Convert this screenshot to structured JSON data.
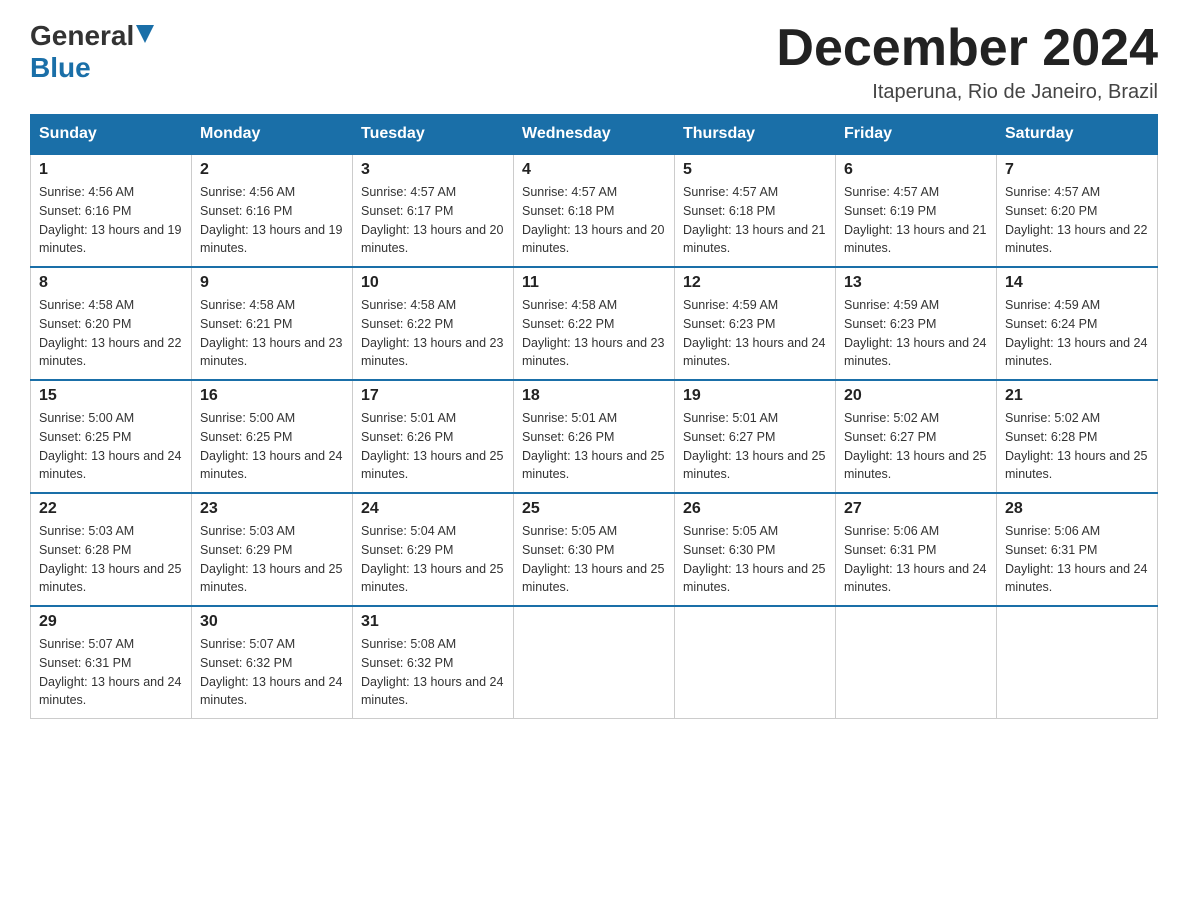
{
  "logo": {
    "part1": "General",
    "part2": "Blue"
  },
  "title": {
    "month_year": "December 2024",
    "location": "Itaperuna, Rio de Janeiro, Brazil"
  },
  "weekdays": [
    "Sunday",
    "Monday",
    "Tuesday",
    "Wednesday",
    "Thursday",
    "Friday",
    "Saturday"
  ],
  "weeks": [
    [
      {
        "day": "1",
        "sunrise": "4:56 AM",
        "sunset": "6:16 PM",
        "daylight": "13 hours and 19 minutes."
      },
      {
        "day": "2",
        "sunrise": "4:56 AM",
        "sunset": "6:16 PM",
        "daylight": "13 hours and 19 minutes."
      },
      {
        "day": "3",
        "sunrise": "4:57 AM",
        "sunset": "6:17 PM",
        "daylight": "13 hours and 20 minutes."
      },
      {
        "day": "4",
        "sunrise": "4:57 AM",
        "sunset": "6:18 PM",
        "daylight": "13 hours and 20 minutes."
      },
      {
        "day": "5",
        "sunrise": "4:57 AM",
        "sunset": "6:18 PM",
        "daylight": "13 hours and 21 minutes."
      },
      {
        "day": "6",
        "sunrise": "4:57 AM",
        "sunset": "6:19 PM",
        "daylight": "13 hours and 21 minutes."
      },
      {
        "day": "7",
        "sunrise": "4:57 AM",
        "sunset": "6:20 PM",
        "daylight": "13 hours and 22 minutes."
      }
    ],
    [
      {
        "day": "8",
        "sunrise": "4:58 AM",
        "sunset": "6:20 PM",
        "daylight": "13 hours and 22 minutes."
      },
      {
        "day": "9",
        "sunrise": "4:58 AM",
        "sunset": "6:21 PM",
        "daylight": "13 hours and 23 minutes."
      },
      {
        "day": "10",
        "sunrise": "4:58 AM",
        "sunset": "6:22 PM",
        "daylight": "13 hours and 23 minutes."
      },
      {
        "day": "11",
        "sunrise": "4:58 AM",
        "sunset": "6:22 PM",
        "daylight": "13 hours and 23 minutes."
      },
      {
        "day": "12",
        "sunrise": "4:59 AM",
        "sunset": "6:23 PM",
        "daylight": "13 hours and 24 minutes."
      },
      {
        "day": "13",
        "sunrise": "4:59 AM",
        "sunset": "6:23 PM",
        "daylight": "13 hours and 24 minutes."
      },
      {
        "day": "14",
        "sunrise": "4:59 AM",
        "sunset": "6:24 PM",
        "daylight": "13 hours and 24 minutes."
      }
    ],
    [
      {
        "day": "15",
        "sunrise": "5:00 AM",
        "sunset": "6:25 PM",
        "daylight": "13 hours and 24 minutes."
      },
      {
        "day": "16",
        "sunrise": "5:00 AM",
        "sunset": "6:25 PM",
        "daylight": "13 hours and 24 minutes."
      },
      {
        "day": "17",
        "sunrise": "5:01 AM",
        "sunset": "6:26 PM",
        "daylight": "13 hours and 25 minutes."
      },
      {
        "day": "18",
        "sunrise": "5:01 AM",
        "sunset": "6:26 PM",
        "daylight": "13 hours and 25 minutes."
      },
      {
        "day": "19",
        "sunrise": "5:01 AM",
        "sunset": "6:27 PM",
        "daylight": "13 hours and 25 minutes."
      },
      {
        "day": "20",
        "sunrise": "5:02 AM",
        "sunset": "6:27 PM",
        "daylight": "13 hours and 25 minutes."
      },
      {
        "day": "21",
        "sunrise": "5:02 AM",
        "sunset": "6:28 PM",
        "daylight": "13 hours and 25 minutes."
      }
    ],
    [
      {
        "day": "22",
        "sunrise": "5:03 AM",
        "sunset": "6:28 PM",
        "daylight": "13 hours and 25 minutes."
      },
      {
        "day": "23",
        "sunrise": "5:03 AM",
        "sunset": "6:29 PM",
        "daylight": "13 hours and 25 minutes."
      },
      {
        "day": "24",
        "sunrise": "5:04 AM",
        "sunset": "6:29 PM",
        "daylight": "13 hours and 25 minutes."
      },
      {
        "day": "25",
        "sunrise": "5:05 AM",
        "sunset": "6:30 PM",
        "daylight": "13 hours and 25 minutes."
      },
      {
        "day": "26",
        "sunrise": "5:05 AM",
        "sunset": "6:30 PM",
        "daylight": "13 hours and 25 minutes."
      },
      {
        "day": "27",
        "sunrise": "5:06 AM",
        "sunset": "6:31 PM",
        "daylight": "13 hours and 24 minutes."
      },
      {
        "day": "28",
        "sunrise": "5:06 AM",
        "sunset": "6:31 PM",
        "daylight": "13 hours and 24 minutes."
      }
    ],
    [
      {
        "day": "29",
        "sunrise": "5:07 AM",
        "sunset": "6:31 PM",
        "daylight": "13 hours and 24 minutes."
      },
      {
        "day": "30",
        "sunrise": "5:07 AM",
        "sunset": "6:32 PM",
        "daylight": "13 hours and 24 minutes."
      },
      {
        "day": "31",
        "sunrise": "5:08 AM",
        "sunset": "6:32 PM",
        "daylight": "13 hours and 24 minutes."
      },
      null,
      null,
      null,
      null
    ]
  ],
  "labels": {
    "sunrise_prefix": "Sunrise: ",
    "sunset_prefix": "Sunset: ",
    "daylight_prefix": "Daylight: "
  }
}
